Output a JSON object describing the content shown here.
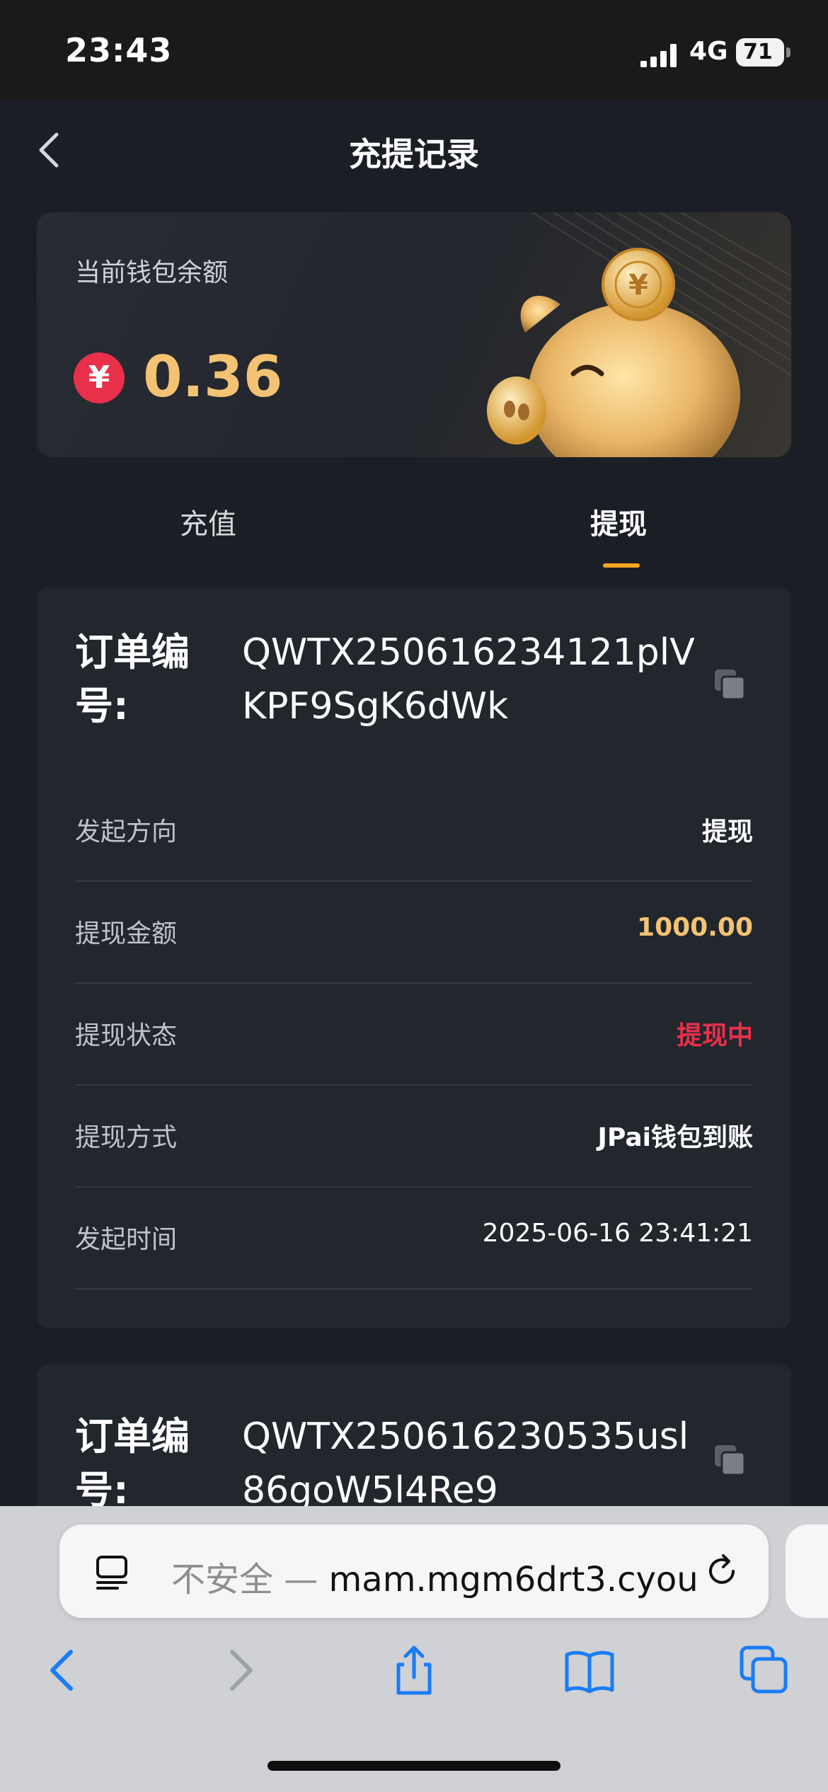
{
  "status": {
    "time": "23:43",
    "network": "4G",
    "battery": "71"
  },
  "nav": {
    "title": "充提记录"
  },
  "wallet": {
    "label": "当前钱包余额",
    "currency_symbol": "¥",
    "balance": "0.36"
  },
  "tabs": [
    {
      "label": "充值",
      "active": false
    },
    {
      "label": "提现",
      "active": true
    }
  ],
  "orders": [
    {
      "order_label": "订单编号:",
      "order_number": "QWTX250616234121plVKPF9SgK6dWk",
      "rows": [
        {
          "label": "发起方向",
          "value": "提现"
        },
        {
          "label": "提现金额",
          "value": "1000.00"
        },
        {
          "label": "提现状态",
          "value": "提现中"
        },
        {
          "label": "提现方式",
          "value": "JPai钱包到账"
        },
        {
          "label": "发起时间",
          "value": "2025-06-16 23:41:21"
        }
      ]
    },
    {
      "order_label": "订单编号:",
      "order_number": "QWTX250616230535usl86goW5l4Re9"
    }
  ],
  "browser": {
    "security": "不安全 — ",
    "domain": "mam.mgm6drt3.cyou"
  },
  "colors": {
    "accent": "#f5a623",
    "amount": "#f3c373",
    "status_red": "#e9304a",
    "ios_blue": "#1a7cf5"
  }
}
